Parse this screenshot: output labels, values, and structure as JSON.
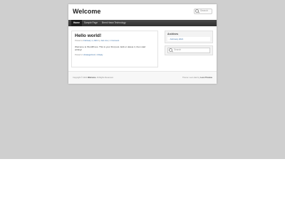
{
  "header": {
    "site_title": "Welcome",
    "search_placeholder": "Search"
  },
  "nav": {
    "items": [
      {
        "label": "Home",
        "active": true
      },
      {
        "label": "Sample Page",
        "active": false
      },
      {
        "label": "Brent Hawn Technology",
        "active": false
      }
    ]
  },
  "post": {
    "title": "Hello world!",
    "meta_prefix": "Posted on",
    "date": "February 1, 2021",
    "by": "by",
    "author": "Just cms",
    "comments_sep": "|",
    "comments": "1 Comment",
    "body": "Welcome to WordPress. This is your first post. Edit or delete it, then start writing!",
    "footer_prefix": "Posted in",
    "category": "Uncategorized",
    "reply": "1 Reply"
  },
  "sidebar": {
    "archives_title": "Archives",
    "archives_items": [
      "February 2021"
    ],
    "search_placeholder": "Search"
  },
  "footer": {
    "copyright_prefix": "Copyright © 2021",
    "site_name": "Welcome",
    "rights": ". All Rights Reserved.",
    "theme_prefix": "Theme: Leon Hart",
    "theme_by": "by",
    "theme_author": "Leon Thomas"
  }
}
